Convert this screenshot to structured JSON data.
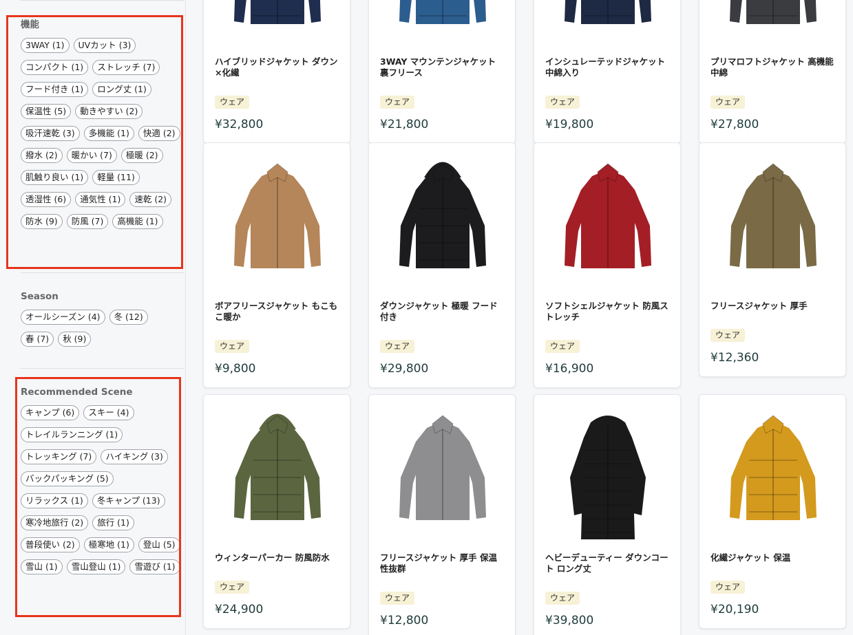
{
  "sidebar": {
    "features": {
      "title": "機能",
      "tags": [
        "3WAY (1)",
        "UVカット (3)",
        "コンパクト (1)",
        "ストレッチ (7)",
        "フード付き (1)",
        "ロング丈 (1)",
        "保温性 (5)",
        "動きやすい (2)",
        "吸汗速乾 (3)",
        "多機能 (1)",
        "快適 (2)",
        "撥水 (2)",
        "暖かい (7)",
        "極暖 (2)",
        "肌触り良い (1)",
        "軽量 (11)",
        "透湿性 (6)",
        "通気性 (1)",
        "速乾 (2)",
        "防水 (9)",
        "防風 (7)",
        "高機能 (1)"
      ]
    },
    "season": {
      "title": "Season",
      "tags": [
        "オールシーズン (4)",
        "冬 (12)",
        "春 (7)",
        "秋 (9)"
      ]
    },
    "scene": {
      "title": "Recommended Scene",
      "tags": [
        "キャンプ (6)",
        "スキー (4)",
        "トレイルランニング (1)",
        "トレッキング (7)",
        "ハイキング (3)",
        "バックパッキング (5)",
        "リラックス (1)",
        "冬キャンプ (13)",
        "寒冷地旅行 (2)",
        "旅行 (1)",
        "普段使い (2)",
        "極寒地 (1)",
        "登山 (5)",
        "雪山 (1)",
        "雪山登山 (1)",
        "雪遊び (1)"
      ]
    }
  },
  "products": [
    {
      "name": "ハイブリッドジャケット ダウン×化繊",
      "badge": "ウェア",
      "price": "¥32,800",
      "color": "#1f2d4f",
      "icon": "jacket-navy"
    },
    {
      "name": "3WAY マウンテンジャケット 裏フリース",
      "badge": "ウェア",
      "price": "¥21,800",
      "color": "#2c5d8f",
      "icon": "jacket-blue"
    },
    {
      "name": "インシュレーテッドジャケット 中綿入り",
      "badge": "ウェア",
      "price": "¥19,800",
      "color": "#1e2a44",
      "icon": "jacket-navy"
    },
    {
      "name": "プリマロフトジャケット 高機能中綿",
      "badge": "ウェア",
      "price": "¥27,800",
      "color": "#3a3c40",
      "icon": "jacket-gray"
    },
    {
      "name": "ボアフリースジャケット もこもこ暖か",
      "badge": "ウェア",
      "price": "¥9,800",
      "color": "#b5865a",
      "icon": "boa-fleece-jacket"
    },
    {
      "name": "ダウンジャケット 極暖 フード付き",
      "badge": "ウェア",
      "price": "¥29,800",
      "color": "#1c1c1e",
      "icon": "down-jacket-hood"
    },
    {
      "name": "ソフトシェルジャケット 防風ストレッチ",
      "badge": "ウェア",
      "price": "¥16,900",
      "color": "#a41e26",
      "icon": "softshell-jacket"
    },
    {
      "name": "フリースジャケット 厚手",
      "badge": "ウェア",
      "price": "¥12,360",
      "color": "#7a6a45",
      "icon": "fleece-jacket"
    },
    {
      "name": "ウィンターパーカー 防風防水",
      "badge": "ウェア",
      "price": "¥24,900",
      "color": "#5b6540",
      "icon": "winter-parka"
    },
    {
      "name": "フリースジャケット 厚手 保温性抜群",
      "badge": "ウェア",
      "price": "¥12,800",
      "color": "#8e8e90",
      "icon": "fleece-jacket-gray"
    },
    {
      "name": "ヘビーデューティー ダウンコート ロング丈",
      "badge": "ウェア",
      "price": "¥39,800",
      "color": "#1a1a1a",
      "icon": "long-down-coat"
    },
    {
      "name": "化繊ジャケット 保温",
      "badge": "ウェア",
      "price": "¥20,190",
      "color": "#d49a1e",
      "icon": "synthetic-jacket"
    }
  ]
}
